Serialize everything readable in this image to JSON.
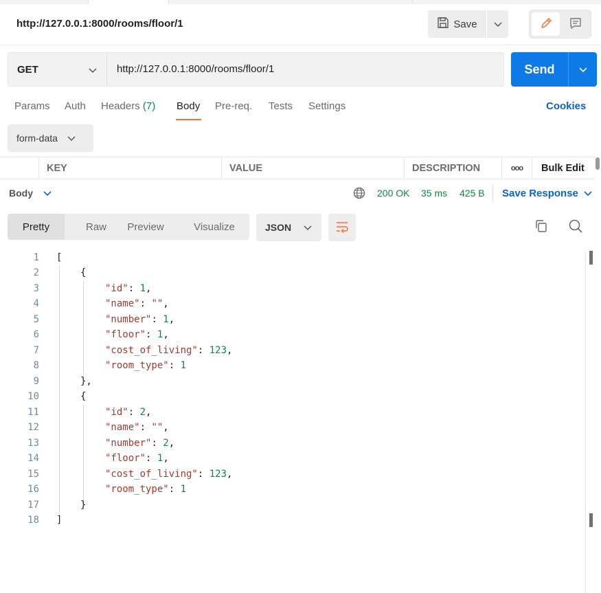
{
  "request": {
    "title": "http://127.0.0.1:8000/rooms/floor/1",
    "save_label": "Save",
    "method": "GET",
    "url": "http://127.0.0.1:8000/rooms/floor/1",
    "send_label": "Send"
  },
  "request_tabs": {
    "params": "Params",
    "auth": "Auth",
    "headers": "Headers",
    "headers_count": "(7)",
    "body": "Body",
    "prereq": "Pre-req.",
    "tests": "Tests",
    "settings": "Settings",
    "cookies": "Cookies"
  },
  "body_type": "form-data",
  "kv_table": {
    "key": "KEY",
    "value": "VALUE",
    "description": "DESCRIPTION",
    "more": "ooo",
    "bulk_edit": "Bulk Edit"
  },
  "response": {
    "label": "Body",
    "status": "200 OK",
    "time": "35 ms",
    "size": "425 B",
    "save_response": "Save Response",
    "view_tabs": {
      "pretty": "Pretty",
      "raw": "Raw",
      "preview": "Preview",
      "visualize": "Visualize"
    },
    "format": "JSON"
  },
  "code": {
    "line_numbers": [
      "1",
      "2",
      "3",
      "4",
      "5",
      "6",
      "7",
      "8",
      "9",
      "10",
      "11",
      "12",
      "13",
      "14",
      "15",
      "16",
      "17",
      "18"
    ],
    "lines": {
      "l1": "[",
      "l2": "{",
      "l3_key": "\"id\"",
      "l3_val": "1",
      "l4_key": "\"name\"",
      "l4_val": "\"\"",
      "l5_key": "\"number\"",
      "l5_val": "1",
      "l6_key": "\"floor\"",
      "l6_val": "1",
      "l7_key": "\"cost_of_living\"",
      "l7_val": "123",
      "l8_key": "\"room_type\"",
      "l8_val": "1",
      "l9": "},",
      "l10": "{",
      "l11_key": "\"id\"",
      "l11_val": "2",
      "l12_key": "\"name\"",
      "l12_val": "\"\"",
      "l13_key": "\"number\"",
      "l13_val": "2",
      "l14_key": "\"floor\"",
      "l14_val": "1",
      "l15_key": "\"cost_of_living\"",
      "l15_val": "123",
      "l16_key": "\"room_type\"",
      "l16_val": "1",
      "l17": "}",
      "l18": "]"
    }
  },
  "colors": {
    "accent_orange": "#ff6c37",
    "send_blue": "#0d7ae6",
    "link_blue": "#0b63c9",
    "status_green": "#0b8a3e",
    "json_key": "#a13b30"
  },
  "icons": [
    "save-icon",
    "chevron-down-icon",
    "pencil-icon",
    "comment-icon",
    "globe-icon",
    "wrap-lines-icon",
    "copy-icon",
    "search-icon"
  ]
}
